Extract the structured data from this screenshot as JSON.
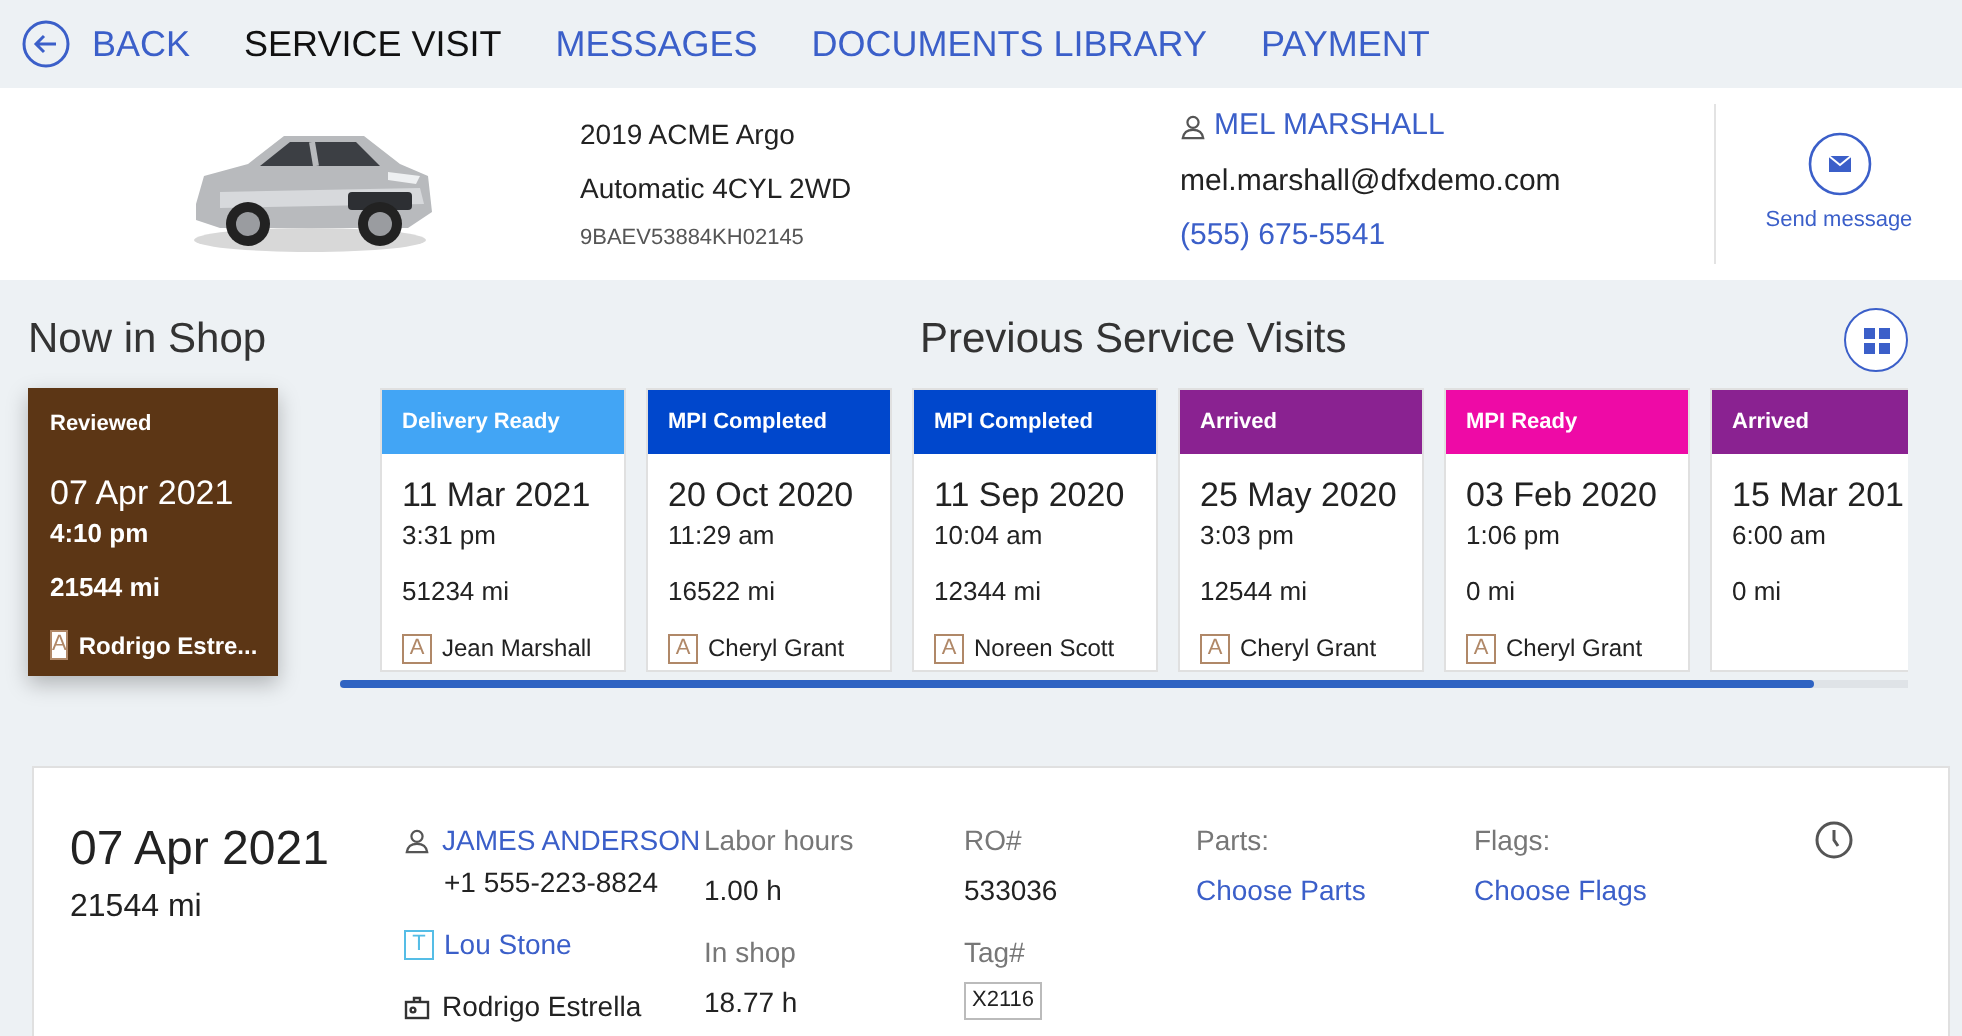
{
  "nav": {
    "back": "BACK",
    "tabs": [
      {
        "label": "SERVICE VISIT",
        "selected": true
      },
      {
        "label": "MESSAGES",
        "selected": false
      },
      {
        "label": "DOCUMENTS LIBRARY",
        "selected": false
      },
      {
        "label": "PAYMENT",
        "selected": false
      }
    ]
  },
  "vehicle": {
    "model": "2019 ACME Argo",
    "spec": "Automatic 4CYL 2WD",
    "vin": "9BAEV53884KH02145"
  },
  "customer": {
    "name": "MEL MARSHALL",
    "email": "mel.marshall@dfxdemo.com",
    "phone": "(555) 675-5541",
    "send": "Send message"
  },
  "now_in_shop": {
    "title": "Now in Shop",
    "status": "Reviewed",
    "color": "#5c3615",
    "date": "07 Apr 2021",
    "time": "4:10 pm",
    "mileage": "21544 mi",
    "badge": "A",
    "advisor": "Rodrigo Estre..."
  },
  "previous": {
    "title": "Previous Service Visits",
    "visits": [
      {
        "status": "Delivery Ready",
        "color": "#42a5f5",
        "date": "11 Mar 2021",
        "time": "3:31 pm",
        "mileage": "51234 mi",
        "badge": "A",
        "advisor": "Jean Marshall"
      },
      {
        "status": "MPI Completed",
        "color": "#0047cc",
        "date": "20 Oct 2020",
        "time": "11:29 am",
        "mileage": "16522 mi",
        "badge": "A",
        "advisor": "Cheryl Grant"
      },
      {
        "status": "MPI Completed",
        "color": "#0047cc",
        "date": "11 Sep 2020",
        "time": "10:04 am",
        "mileage": "12344 mi",
        "badge": "A",
        "advisor": "Noreen Scott"
      },
      {
        "status": "Arrived",
        "color": "#8a2291",
        "date": "25 May 2020",
        "time": "3:03 pm",
        "mileage": "12544 mi",
        "badge": "A",
        "advisor": "Cheryl Grant"
      },
      {
        "status": "MPI Ready",
        "color": "#ee0aa6",
        "date": "03 Feb 2020",
        "time": "1:06 pm",
        "mileage": "0 mi",
        "badge": "A",
        "advisor": "Cheryl Grant"
      },
      {
        "status": "Arrived",
        "color": "#8a2291",
        "date": "15 Mar 201",
        "time": "6:00 am",
        "mileage": "0 mi"
      }
    ]
  },
  "detail": {
    "date": "07 Apr 2021",
    "mileage": "21544 mi",
    "customer": "JAMES ANDERSON",
    "phone": "+1 555-223-8824",
    "tech_badge": "T",
    "technician": "Lou Stone",
    "advisor": "Rodrigo Estrella",
    "labor_label": "Labor hours",
    "labor": "1.00 h",
    "inshop_label": "In shop",
    "inshop": "18.77 h",
    "ro_label": "RO#",
    "ro": "533036",
    "tag_label": "Tag#",
    "tag": "X2116",
    "parts_label": "Parts:",
    "parts": "Choose Parts",
    "flags_label": "Flags:",
    "flags": "Choose Flags"
  }
}
